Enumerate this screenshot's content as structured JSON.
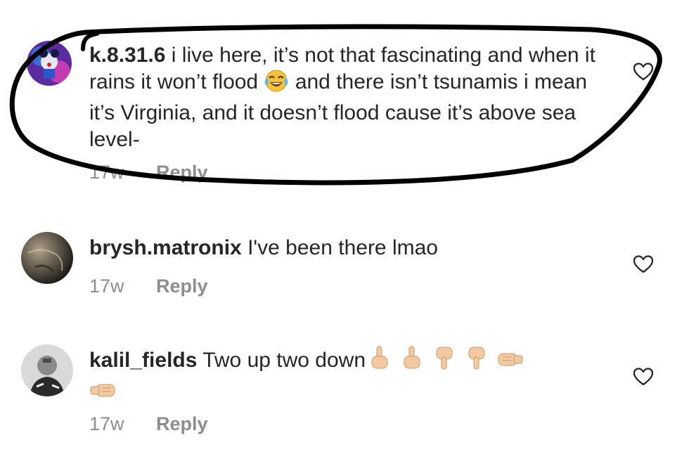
{
  "comments": [
    {
      "username": "k.8.31.6",
      "text_a": "i live here, it’s not that fascinating and when it rains it won’t flood",
      "text_b": "and there isn’t tsunamis i mean it’s Virginia, and it doesn’t flood cause it’s above sea level-",
      "time": "17w",
      "reply_label": "Reply",
      "emoji": "face-with-tears-of-joy"
    },
    {
      "username": "brysh.matronix",
      "text": "I've been there lmao",
      "time": "17w",
      "reply_label": "Reply"
    },
    {
      "username": "kalil_fields",
      "text": "Two up two down",
      "time": "17w",
      "reply_label": "Reply",
      "emoji": [
        "hand-pointing-up",
        "hand-pointing-up",
        "hand-pointing-down",
        "hand-pointing-down",
        "fist-left",
        "fist-right"
      ]
    }
  ],
  "icons": {
    "like": "heart-outline-icon"
  },
  "colors": {
    "text": "#262626",
    "meta": "#8e8e8e",
    "annotation": "#000000",
    "skin": "#f2c9a0"
  }
}
